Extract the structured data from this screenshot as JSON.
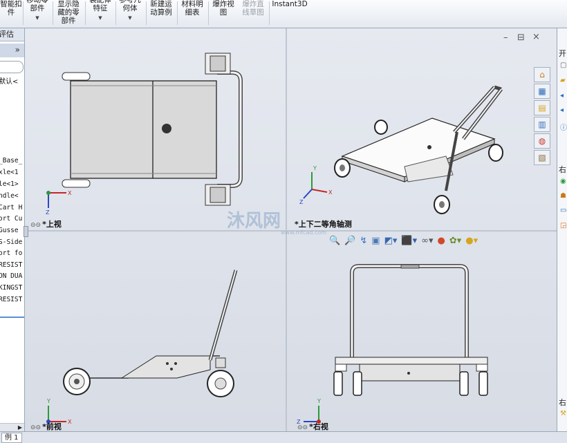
{
  "toolbar": {
    "items": [
      {
        "label": "智能扣\n件",
        "dropdown": false,
        "disabled": false
      },
      {
        "label": "移动零\n部件",
        "dropdown": true,
        "disabled": false
      },
      {
        "label": "显示隐\n藏的零\n部件",
        "dropdown": false,
        "disabled": false
      },
      {
        "label": "装配体\n特征",
        "dropdown": true,
        "disabled": false
      },
      {
        "label": "参考几\n何体",
        "dropdown": true,
        "disabled": false
      },
      {
        "label": "新建运\n动算例",
        "dropdown": false,
        "disabled": false
      },
      {
        "label": "材料明\n细表",
        "dropdown": false,
        "disabled": false
      },
      {
        "label": "爆炸视\n图",
        "dropdown": false,
        "disabled": false
      },
      {
        "label": "爆炸直\n线草图",
        "dropdown": false,
        "disabled": true
      },
      {
        "label": "Instant3D",
        "dropdown": false,
        "disabled": false
      }
    ]
  },
  "left_panel": {
    "tab_label": "评估",
    "collapse_chevron": "»",
    "config_text": "默认<",
    "tree_items": [
      "_Base_",
      "xle<1",
      "le<1>",
      "ndle<",
      "Cart H",
      "ort Cu",
      "Gusse",
      "S-Side",
      "ort fo",
      "RESIST",
      "ON DUA",
      "KINGST",
      "RESIST"
    ]
  },
  "viewports": {
    "top": "*上视",
    "iso": "*上下二等角轴测",
    "front": "*前视",
    "right": "*右视"
  },
  "triad": {
    "x": "X",
    "y": "Y",
    "z": "Z"
  },
  "window_controls": [
    "–",
    "⊟",
    "×"
  ],
  "watermark": {
    "text": "沐风网",
    "url": "www.mfcad.com"
  },
  "right_panel": {
    "header1": "开",
    "header2": "右",
    "header3": "右"
  },
  "bottom": {
    "tab": "例 1"
  },
  "colors": {
    "accent": "#1f5fbf",
    "background": "#dde1e9",
    "panel": "#ffffff"
  }
}
